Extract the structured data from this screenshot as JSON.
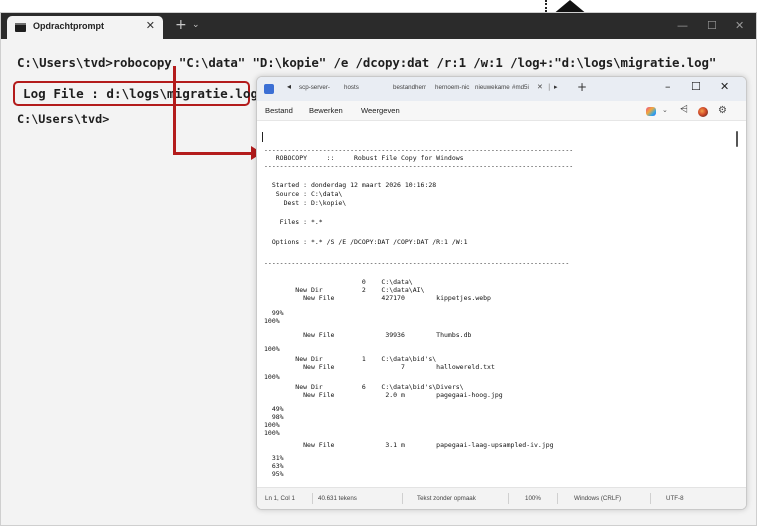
{
  "terminal": {
    "tab_title": "Opdrachtprompt",
    "tab_close": "✕",
    "new_tab": "+",
    "dropdown": "⌄",
    "controls": {
      "minimize": "—",
      "maximize": "☐",
      "close": "✕"
    },
    "command_line": "C:\\Users\\tvd>robocopy \"C:\\data\" \"D:\\kopie\" /e /dcopy:dat /r:1 /w:1 /log+:\"d:\\logs\\migratie.log\"",
    "log_line": "Log File : d:\\logs\\migratie.log",
    "prompt": "C:\\Users\\tvd>",
    "highlight_color": "#b31b1b"
  },
  "notepad": {
    "back": "◂",
    "tabs": [
      "scp-server-",
      "hosts",
      "bestandherr",
      "hernoem-nic",
      "nieuwekame",
      "#md5i"
    ],
    "tab_close": "✕",
    "tab_sep": "|",
    "tab_fwd": "▸",
    "add_tab": "+",
    "controls": {
      "minimize": "–",
      "maximize": "☐",
      "close": "✕"
    },
    "menu": [
      "Bestand",
      "Bewerken",
      "Weergeven"
    ],
    "toolbar": {
      "chevron": "⌄",
      "share": "⩤",
      "settings": "⚙"
    },
    "log": {
      "sep_top": "-------------------------------------------------------------------------------",
      "header": "   ROBOCOPY     ::     Robust File Copy for Windows",
      "sep_mid": "-------------------------------------------------------------------------------",
      "started": "  Started : donderdag 12 maart 2026 10:16:28",
      "source": "   Source : C:\\data\\",
      "dest": "     Dest : D:\\kopie\\",
      "files": "    Files : *.*",
      "options": "  Options : *.* /S /E /DCOPY:DAT /COPY:DAT /R:1 /W:1",
      "sep_bottom": "------------------------------------------------------------------------------",
      "lines": [
        "                         0    C:\\data\\",
        "        New Dir          2    C:\\data\\AI\\",
        "          New File            427170        kippetjes.webp",
        "  99%",
        "100%",
        "          New File             39936        Thumbs.db",
        "100%",
        "        New Dir          1    C:\\data\\bid's\\",
        "          New File                 7        hallowereld.txt",
        "100%",
        "        New Dir          6    C:\\data\\bid's\\Divers\\",
        "          New File             2.0 m        pagegaai-hoog.jpg",
        "  49%",
        "  98%",
        "100%",
        "100%",
        "          New File             3.1 m        papegaai-laag-upsampled-iv.jpg",
        "  31%",
        "  63%",
        "  95%"
      ]
    },
    "status": [
      "Ln 1, Col 1",
      "40.631 tekens",
      "Tekst zonder opmaak",
      "100%",
      "Windows (CRLF)",
      "UTF-8"
    ]
  }
}
